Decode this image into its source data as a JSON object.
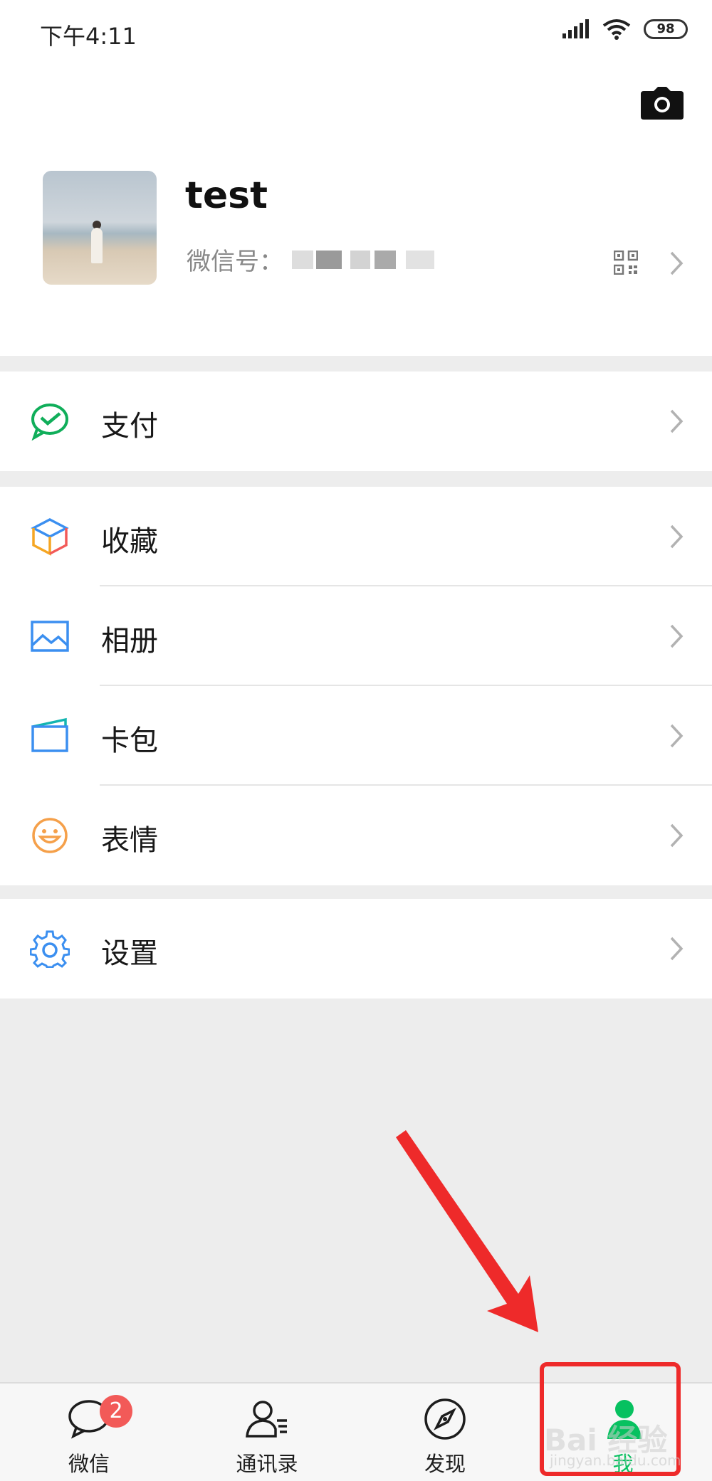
{
  "status_bar": {
    "time": "下午4:11",
    "battery": "98"
  },
  "profile": {
    "name": "test",
    "wechat_id_label": "微信号："
  },
  "menu": {
    "pay": "支付",
    "favorites": "收藏",
    "album": "相册",
    "cards": "卡包",
    "stickers": "表情",
    "settings": "设置"
  },
  "tabbar": {
    "chats": {
      "label": "微信",
      "badge": "2"
    },
    "contacts": {
      "label": "通讯录"
    },
    "discover": {
      "label": "发现"
    },
    "me": {
      "label": "我"
    }
  },
  "watermark": {
    "text": "Bai 经验",
    "sub": "jingyan.baidu.com"
  },
  "colors": {
    "accent_green": "#07c160",
    "annotation_red": "#ee2a2a",
    "badge_red": "#f25a58"
  }
}
